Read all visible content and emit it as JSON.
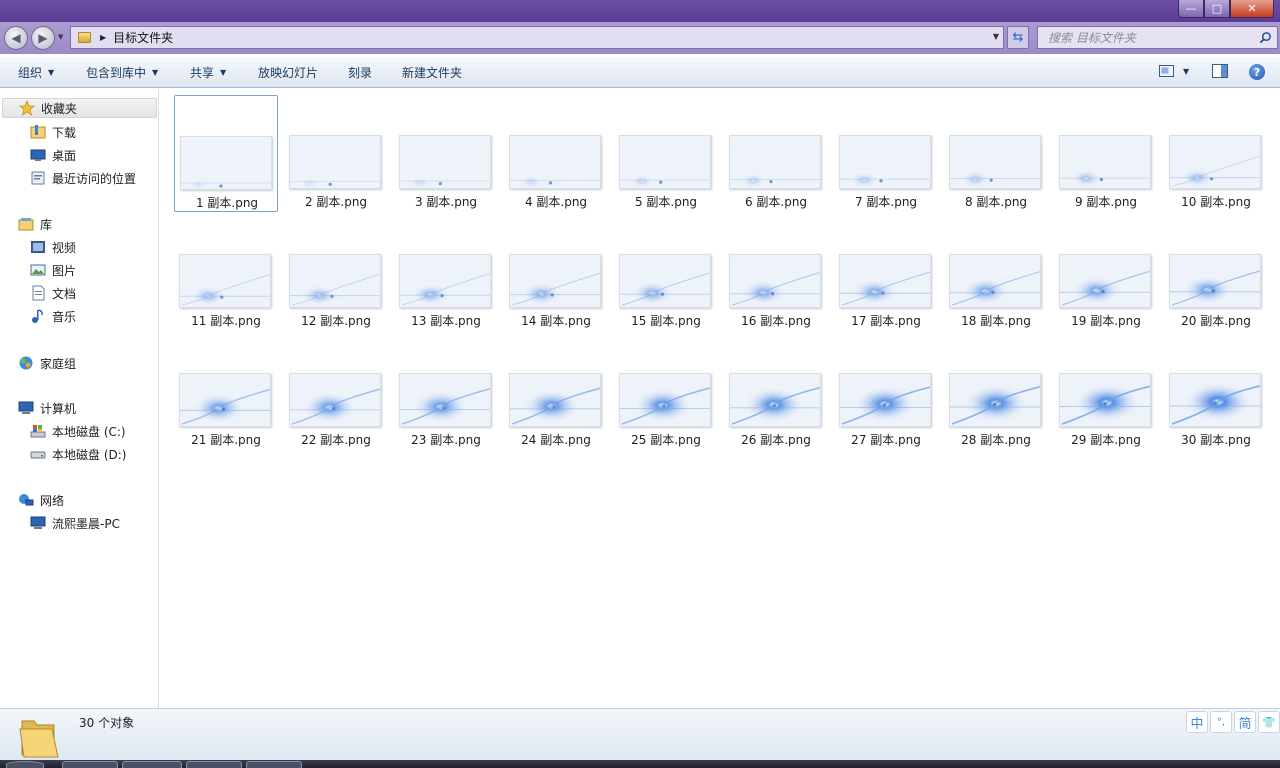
{
  "window": {
    "min_glyph": "—",
    "max_glyph": "□",
    "close_glyph": "✕"
  },
  "address": {
    "path": "目标文件夹",
    "search_placeholder": "搜索 目标文件夹"
  },
  "toolbar": {
    "organize": "组织",
    "include_in_library": "包含到库中",
    "share": "共享",
    "slideshow": "放映幻灯片",
    "burn": "刻录",
    "new_folder": "新建文件夹",
    "help": "?"
  },
  "nav": {
    "favorites": "收藏夹",
    "downloads": "下载",
    "desktop": "桌面",
    "recent": "最近访问的位置",
    "libraries": "库",
    "videos": "视频",
    "pictures": "图片",
    "documents": "文档",
    "music": "音乐",
    "homegroup": "家庭组",
    "computer": "计算机",
    "drive_c": "本地磁盘 (C:)",
    "drive_d": "本地磁盘 (D:)",
    "network": "网络",
    "pc": "流熙墨晨-PC"
  },
  "files": [
    "1 副本.png",
    "2 副本.png",
    "3 副本.png",
    "4 副本.png",
    "5 副本.png",
    "6 副本.png",
    "7 副本.png",
    "8 副本.png",
    "9 副本.png",
    "10 副本.png",
    "11 副本.png",
    "12 副本.png",
    "13 副本.png",
    "14 副本.png",
    "15 副本.png",
    "16 副本.png",
    "17 副本.png",
    "18 副本.png",
    "19 副本.png",
    "20 副本.png",
    "21 副本.png",
    "22 副本.png",
    "23 副本.png",
    "24 副本.png",
    "25 副本.png",
    "26 副本.png",
    "27 副本.png",
    "28 副本.png",
    "29 副本.png",
    "30 副本.png"
  ],
  "selected_file_index": 0,
  "status": {
    "count": "30 个对象"
  },
  "ime": {
    "lang": "中",
    "mode": "°,",
    "simplified": "简",
    "tool": "👕"
  },
  "colors": {
    "accent": "#6d4fa8",
    "selection": "#7da2ce",
    "thumb_glow": "#3d7fe0"
  }
}
